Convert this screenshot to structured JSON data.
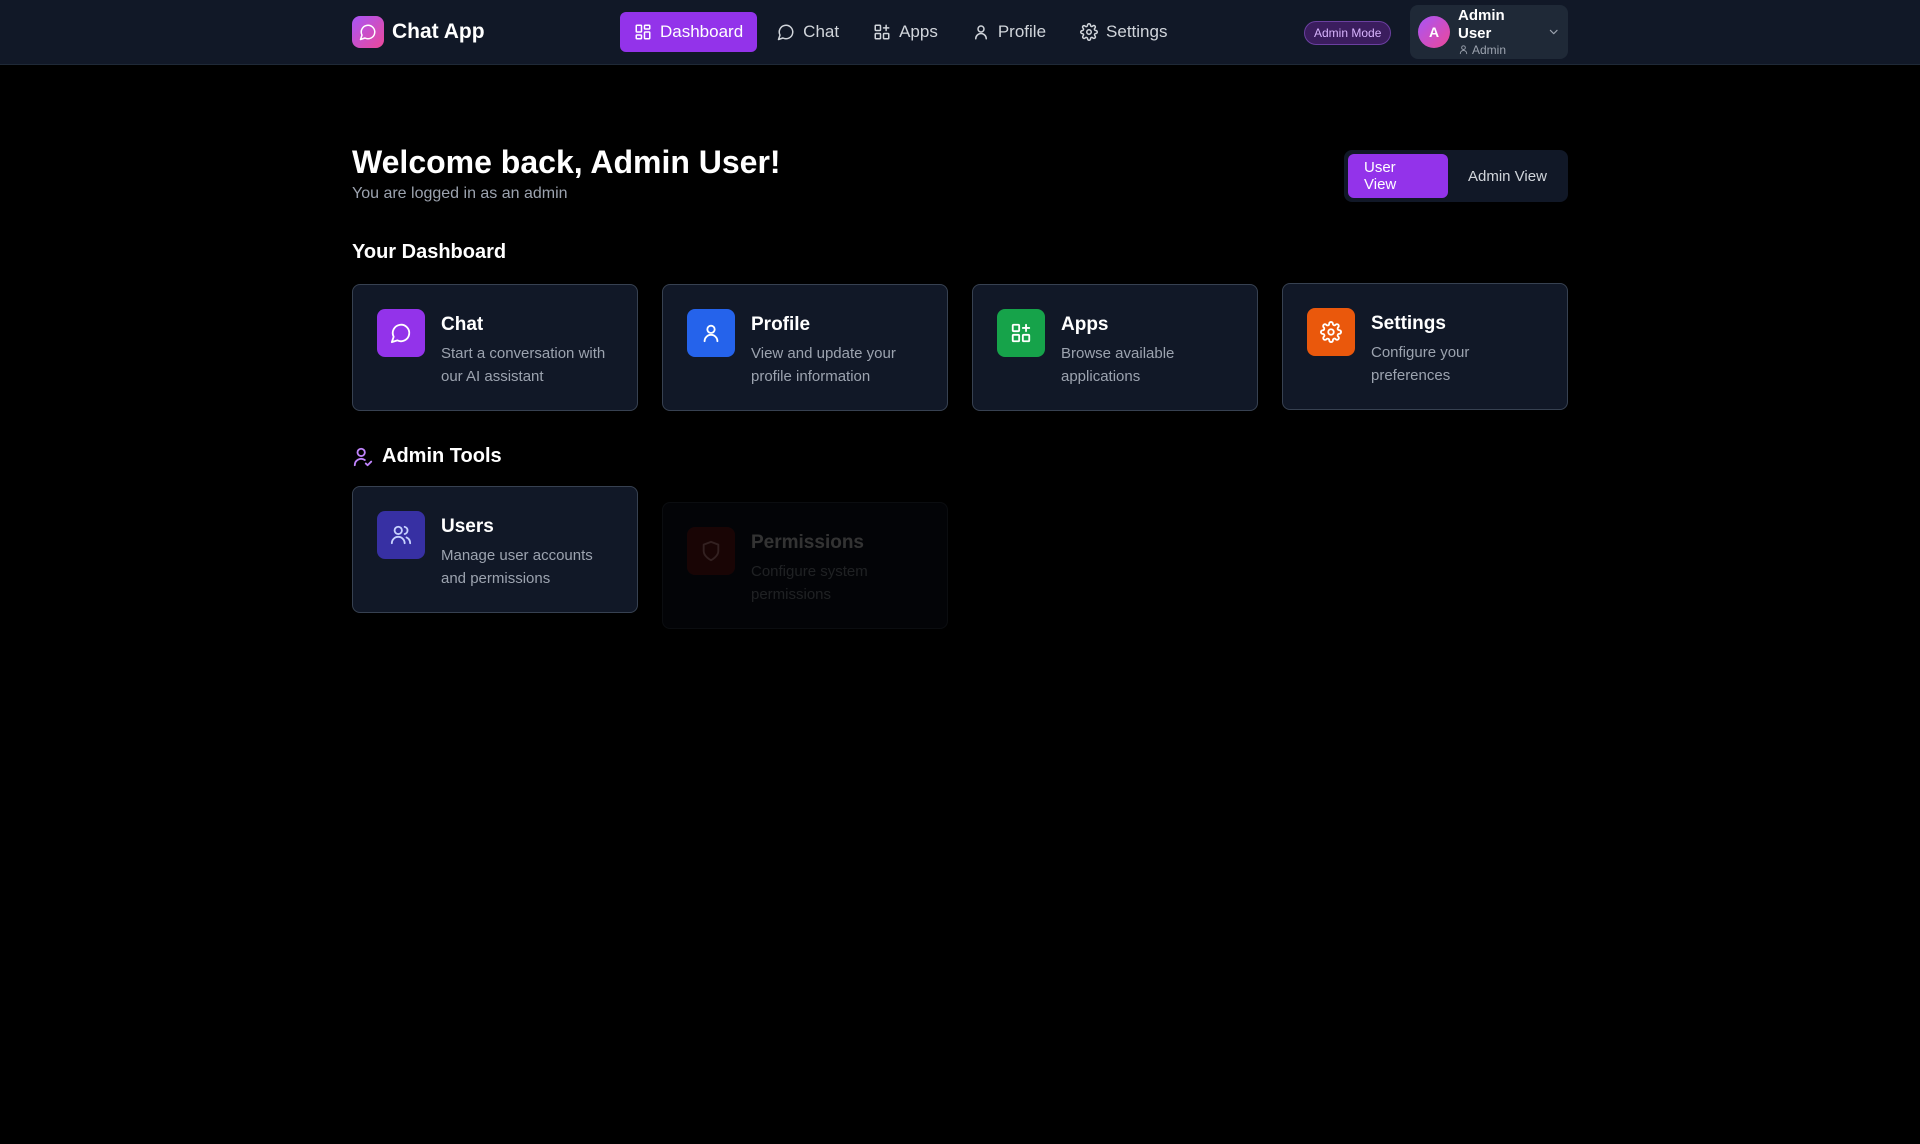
{
  "brand": {
    "name": "Chat App",
    "icon": "message-circle-icon"
  },
  "nav": {
    "items": [
      {
        "label": "Dashboard",
        "icon": "layout-dashboard-icon",
        "active": true
      },
      {
        "label": "Chat",
        "icon": "message-circle-icon",
        "active": false
      },
      {
        "label": "Apps",
        "icon": "apps-grid-icon",
        "active": false
      },
      {
        "label": "Profile",
        "icon": "user-icon",
        "active": false
      },
      {
        "label": "Settings",
        "icon": "gear-icon",
        "active": false
      }
    ]
  },
  "header": {
    "admin_badge": "Admin Mode",
    "user": {
      "initial": "A",
      "name": "Admin User",
      "role": "Admin"
    }
  },
  "welcome": {
    "title": "Welcome back, Admin User!",
    "subtitle": "You are logged in as an admin"
  },
  "view_toggle": {
    "user_view": "User View",
    "admin_view": "Admin View",
    "selected": "User View"
  },
  "dashboard": {
    "title": "Your Dashboard",
    "cards": [
      {
        "title": "Chat",
        "description": "Start a conversation with our AI assistant",
        "icon": "message-circle-icon",
        "color": "#9333ea"
      },
      {
        "title": "Profile",
        "description": "View and update your profile information",
        "icon": "user-icon",
        "color": "#2563eb"
      },
      {
        "title": "Apps",
        "description": "Browse available applications",
        "icon": "apps-grid-icon",
        "color": "#16a34a"
      },
      {
        "title": "Settings",
        "description": "Configure your preferences",
        "icon": "gear-icon",
        "color": "#ea580c"
      }
    ]
  },
  "admin_tools": {
    "title": "Admin Tools",
    "icon": "user-check-icon",
    "cards": [
      {
        "title": "Users",
        "description": "Manage user accounts and permissions",
        "icon": "users-icon",
        "color": "#3730a3",
        "enabled": true
      },
      {
        "title": "Permissions",
        "description": "Configure system permissions",
        "icon": "shield-icon",
        "color": "#7f1d1d",
        "enabled": false
      }
    ]
  }
}
